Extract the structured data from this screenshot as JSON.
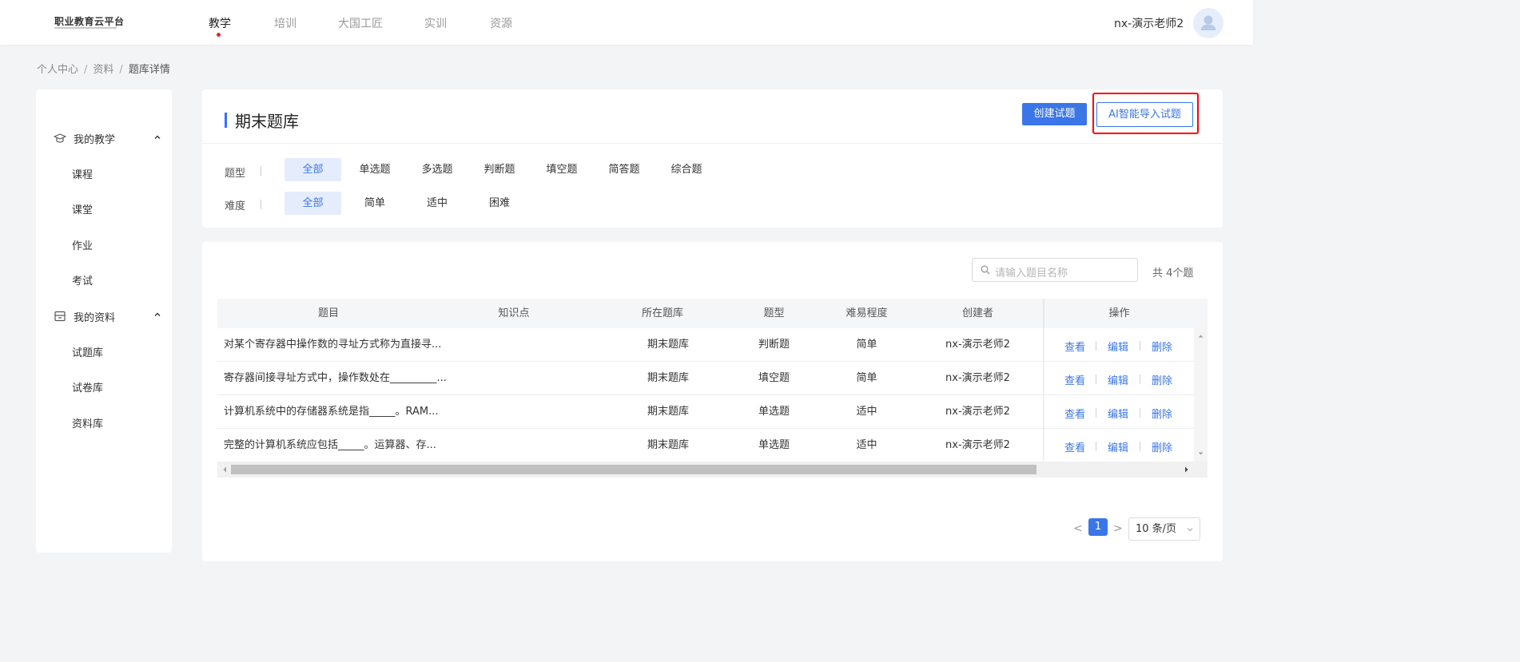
{
  "app": {
    "logo_text": "职业教育云平台"
  },
  "nav": {
    "items": [
      "教学",
      "培训",
      "大国工匠",
      "实训",
      "资源"
    ],
    "active": "教学",
    "username": "nx-演示老师2"
  },
  "breadcrumb": {
    "items": [
      "个人中心",
      "资料",
      "题库详情"
    ],
    "separator": "/"
  },
  "sidebar": {
    "groups": [
      {
        "label": "我的教学",
        "icon": "graduation-cap-icon",
        "items": [
          "课程",
          "课堂",
          "作业",
          "考试"
        ]
      },
      {
        "label": "我的资料",
        "icon": "archive-box-icon",
        "items": [
          "试题库",
          "试卷库",
          "资料库"
        ]
      }
    ]
  },
  "header": {
    "title": "期末题库",
    "create_button": "创建试题",
    "ai_import_button": "AI智能导入试题"
  },
  "filters": {
    "type_label": "题型",
    "type_options": [
      "全部",
      "单选题",
      "多选题",
      "判断题",
      "填空题",
      "简答题",
      "综合题"
    ],
    "type_selected": "全部",
    "difficulty_label": "难度",
    "difficulty_options": [
      "全部",
      "简单",
      "适中",
      "困难"
    ],
    "difficulty_selected": "全部"
  },
  "search": {
    "placeholder": "请输入题目名称",
    "total_text": "共 4个题"
  },
  "table": {
    "columns": [
      "题目",
      "知识点",
      "所在题库",
      "题型",
      "难易程度",
      "创建者",
      "操作"
    ],
    "rows": [
      {
        "question": "对某个寄存器中操作数的寻址方式称为直接寻...",
        "knowledge": "",
        "bank": "期末题库",
        "type": "判断题",
        "difficulty": "简单",
        "creator": "nx-演示老师2"
      },
      {
        "question": "寄存器间接寻址方式中，操作数处在_________...",
        "knowledge": "",
        "bank": "期末题库",
        "type": "填空题",
        "difficulty": "简单",
        "creator": "nx-演示老师2"
      },
      {
        "question": "计算机系统中的存储器系统是指_____。RAM...",
        "knowledge": "",
        "bank": "期末题库",
        "type": "单选题",
        "difficulty": "适中",
        "creator": "nx-演示老师2"
      },
      {
        "question": "完整的计算机系统应包括_____。运算器、存...",
        "knowledge": "",
        "bank": "期末题库",
        "type": "单选题",
        "difficulty": "适中",
        "creator": "nx-演示老师2"
      }
    ],
    "actions": [
      "查看",
      "编辑",
      "删除"
    ]
  },
  "pagination": {
    "current_page": "1",
    "page_size": "10 条/页",
    "prev": "<",
    "next": ">"
  },
  "colors": {
    "accent": "#3b76e8",
    "highlight": "#ff0000",
    "nav_dot": "#e0252b"
  }
}
